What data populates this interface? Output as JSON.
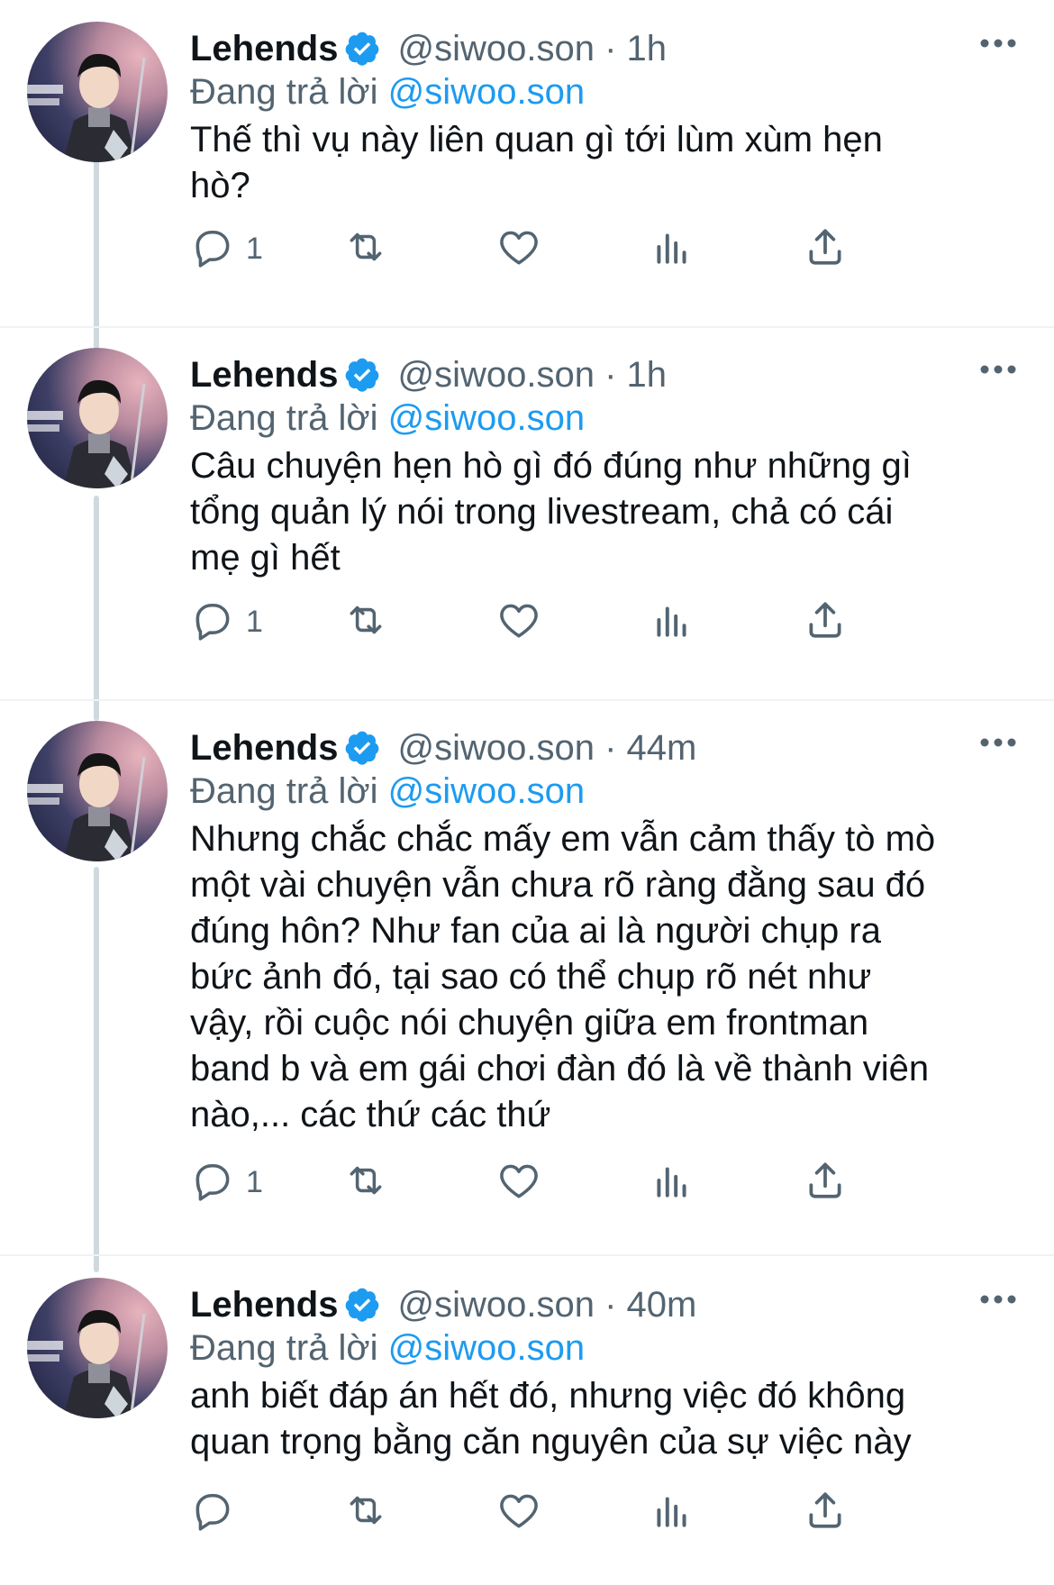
{
  "tweets": [
    {
      "display_name": "Lehends",
      "handle": "@siwoo.son",
      "time": "1h",
      "replying_prefix": "Đang trả lời",
      "replying_to": "@siwoo.son",
      "text_lines": [
        "Thế thì vụ này liên quan gì tới lùm xùm hẹn",
        "hò?"
      ],
      "reply_count": "1"
    },
    {
      "display_name": "Lehends",
      "handle": "@siwoo.son",
      "time": "1h",
      "replying_prefix": "Đang trả lời",
      "replying_to": "@siwoo.son",
      "text_lines": [
        "Câu chuyện hẹn hò gì đó đúng như những gì",
        "tổng quản lý nói trong livestream, chả có cái",
        "mẹ gì hết"
      ],
      "reply_count": "1"
    },
    {
      "display_name": "Lehends",
      "handle": "@siwoo.son",
      "time": "44m",
      "replying_prefix": "Đang trả lời",
      "replying_to": "@siwoo.son",
      "text_lines": [
        "Nhưng chắc chắc mấy em vẫn cảm thấy tò mò",
        "một vài chuyện vẫn chưa rõ ràng đằng sau đó",
        "đúng hôn? Như fan của ai là người chụp ra",
        "bức ảnh đó, tại sao có thể chụp rõ nét như",
        "vậy, rồi cuộc nói chuyện giữa em frontman",
        "band b và em gái chơi đàn đó là về thành viên",
        "nào,... các thứ các thứ"
      ],
      "reply_count": "1"
    },
    {
      "display_name": "Lehends",
      "handle": "@siwoo.son",
      "time": "40m",
      "replying_prefix": "Đang trả lời",
      "replying_to": "@siwoo.son",
      "text_lines": [
        "anh biết đáp án hết đó, nhưng việc đó không",
        "quan trọng bằng căn nguyên của sự việc này"
      ],
      "reply_count": ""
    }
  ],
  "icons": {
    "verified": "verified-badge-icon",
    "more": "more-options-icon",
    "reply": "reply-icon",
    "retweet": "retweet-icon",
    "like": "heart-icon",
    "views": "analytics-icon",
    "share": "share-icon"
  },
  "colors": {
    "text": "#0f1419",
    "secondary": "#536471",
    "accent": "#1d9bf0",
    "thread_line": "#cfd9de"
  }
}
